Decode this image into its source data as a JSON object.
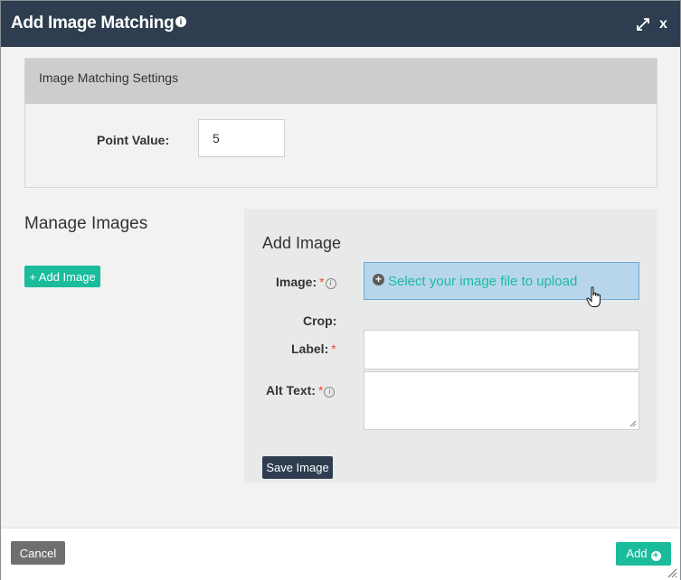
{
  "dialog": {
    "title": "Add Image Matching",
    "info_icon": "info-circle-icon",
    "expand_icon": "expand-arrows-icon",
    "close_label": "x"
  },
  "settings": {
    "header": "Image Matching Settings",
    "point_value_label": "Point Value:",
    "point_value": "5"
  },
  "manage": {
    "title": "Manage Images",
    "add_image_button": "+ Add Image"
  },
  "add_image_form": {
    "title": "Add Image",
    "image_label": "Image:",
    "upload_text": "Select your image file to upload",
    "crop_label": "Crop:",
    "label_label": "Label:",
    "alt_text_label": "Alt Text:",
    "required_marker": "*",
    "info_marker": "i",
    "save_button": "Save Image",
    "label_value": "",
    "alt_text_value": ""
  },
  "footer": {
    "cancel_button": "Cancel",
    "add_button": "Add",
    "add_icon": "plus-circle-icon"
  },
  "colors": {
    "titlebar": "#2e3e50",
    "accent_green": "#1abc9c",
    "required_red": "#e74c3c",
    "upload_bg": "#b7d6ec"
  }
}
